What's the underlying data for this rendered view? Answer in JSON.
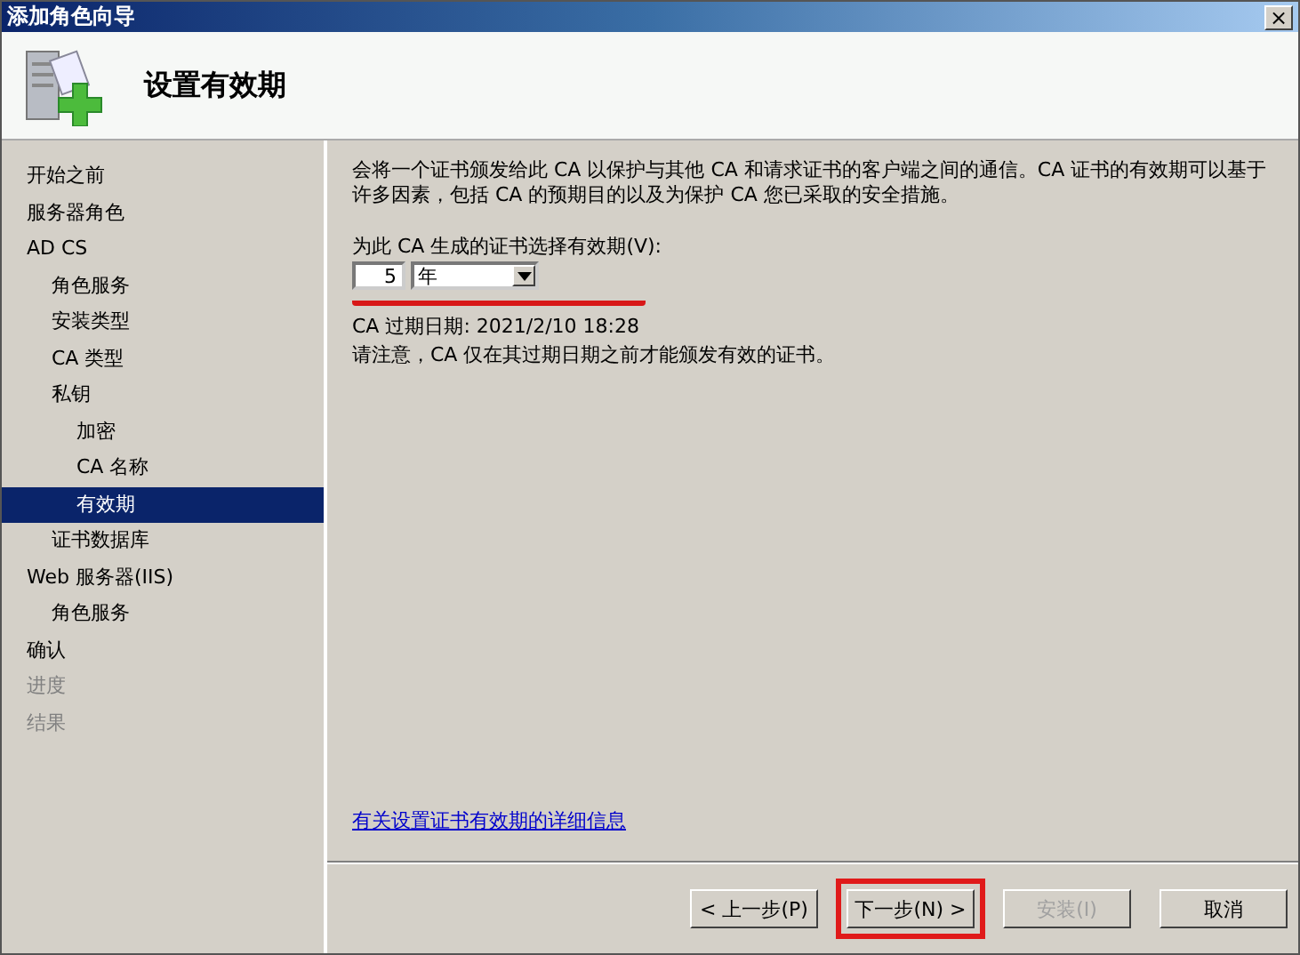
{
  "window": {
    "title": "添加角色向导",
    "close_button": "×"
  },
  "header": {
    "title": "设置有效期"
  },
  "sidebar": {
    "items": [
      {
        "label": "开始之前",
        "selected": false,
        "disabled": false
      },
      {
        "label": "服务器角色",
        "selected": false,
        "disabled": false
      },
      {
        "label": "AD CS",
        "selected": false,
        "disabled": false,
        "children": [
          {
            "label": "角色服务",
            "selected": false,
            "disabled": false
          },
          {
            "label": "安装类型",
            "selected": false,
            "disabled": false
          },
          {
            "label": "CA 类型",
            "selected": false,
            "disabled": false
          },
          {
            "label": "私钥",
            "selected": false,
            "disabled": false,
            "children": [
              {
                "label": "加密",
                "selected": false,
                "disabled": false
              },
              {
                "label": "CA 名称",
                "selected": false,
                "disabled": false
              },
              {
                "label": "有效期",
                "selected": true,
                "disabled": false
              }
            ]
          },
          {
            "label": "证书数据库",
            "selected": false,
            "disabled": false
          }
        ]
      },
      {
        "label": "Web 服务器(IIS)",
        "selected": false,
        "disabled": false,
        "children": [
          {
            "label": "角色服务",
            "selected": false,
            "disabled": false
          }
        ]
      },
      {
        "label": "确认",
        "selected": false,
        "disabled": false
      },
      {
        "label": "进度",
        "selected": false,
        "disabled": true
      },
      {
        "label": "结果",
        "selected": false,
        "disabled": true
      }
    ]
  },
  "content": {
    "description": "会将一个证书颁发给此 CA 以保护与其他 CA 和请求证书的客户端之间的通信。CA 证书的有效期可以基于许多因素，包括 CA 的预期目的以及为保护 CA 您已采取的安全措施。",
    "period_label": "为此 CA 生成的证书选择有效期(V):",
    "period_value": "5",
    "period_unit": "年",
    "period_underlined": true,
    "expiry": "CA 过期日期:  2021/2/10 18:28",
    "note": "请注意，CA 仅在其过期日期之前才能颁发有效的证书。",
    "help_link": "有关设置证书有效期的详细信息"
  },
  "buttons": [
    {
      "label": "< 上一步(P)",
      "disabled": false,
      "highlighted": false
    },
    {
      "label": "下一步(N) >",
      "disabled": false,
      "highlighted": true
    },
    {
      "label": "安装(I)",
      "disabled": true,
      "highlighted": false
    },
    {
      "label": "取消",
      "disabled": false,
      "highlighted": false
    }
  ]
}
